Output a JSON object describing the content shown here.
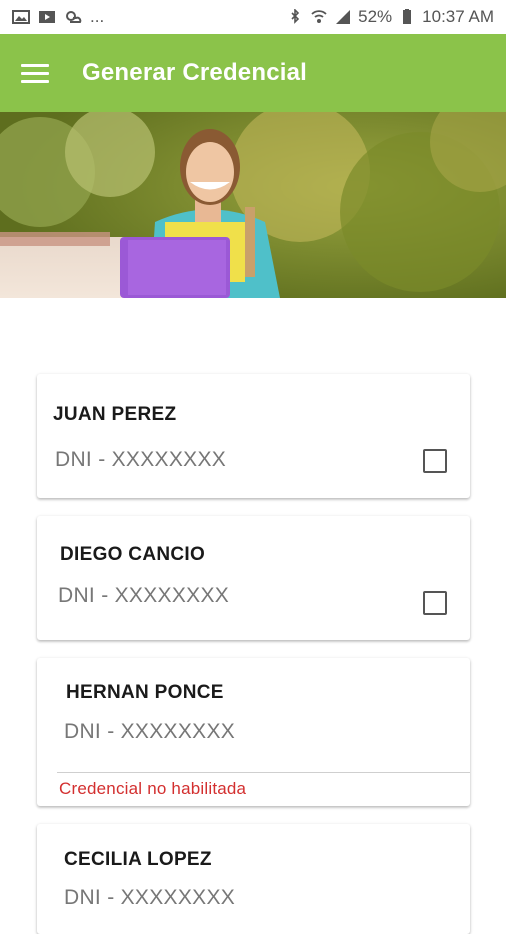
{
  "status_bar": {
    "left_icons": [
      "gallery-icon",
      "play-store-icon",
      "weather-icon"
    ],
    "overflow": "...",
    "battery": "52%",
    "time": "10:37 AM"
  },
  "app_bar": {
    "title": "Generar Credencial",
    "menu_icon": "hamburger-menu-icon",
    "color": "#8bc34a"
  },
  "cards": [
    {
      "name": "JUAN PEREZ",
      "dni": "DNI - XXXXXXXX",
      "checkbox": true,
      "checked": false
    },
    {
      "name": "DIEGO CANCIO",
      "dni": "DNI - XXXXXXXX",
      "checkbox": true,
      "checked": false
    },
    {
      "name": "HERNAN PONCE",
      "dni": "DNI - XXXXXXXX",
      "checkbox": false,
      "error": "Credencial no habilitada"
    },
    {
      "name": "CECILIA LOPEZ",
      "dni": "DNI - XXXXXXXX",
      "checkbox": false
    }
  ],
  "colors": {
    "error": "#d32f2f",
    "accent": "#8bc34a"
  }
}
